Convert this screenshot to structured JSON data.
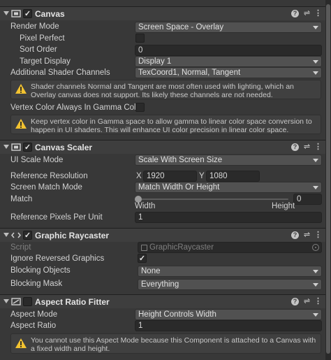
{
  "canvas": {
    "title": "Canvas",
    "render_mode_label": "Render Mode",
    "render_mode_value": "Screen Space - Overlay",
    "pixel_perfect_label": "Pixel Perfect",
    "sort_order_label": "Sort Order",
    "sort_order_value": "0",
    "target_display_label": "Target Display",
    "target_display_value": "Display 1",
    "shader_channels_label": "Additional Shader Channels",
    "shader_channels_value": "TexCoord1, Normal, Tangent",
    "warning1": "Shader channels Normal and Tangent are most often used with lighting, which an Overlay canvas does not support. Its likely these channels are not needed.",
    "vertex_color_label": "Vertex Color Always In Gamma Color",
    "warning2": "Keep vertex color in Gamma space to allow gamma to linear color space conversion to happen in UI shaders. This will enhance UI color precision in linear color space."
  },
  "canvas_scaler": {
    "title": "Canvas Scaler",
    "ui_scale_mode_label": "UI Scale Mode",
    "ui_scale_mode_value": "Scale With Screen Size",
    "ref_resolution_label": "Reference Resolution",
    "x_label": "X",
    "x_value": "1920",
    "y_label": "Y",
    "y_value": "1080",
    "screen_match_mode_label": "Screen Match Mode",
    "screen_match_mode_value": "Match Width Or Height",
    "match_label": "Match",
    "match_value": "0",
    "match_min_label": "Width",
    "match_max_label": "Height",
    "ref_ppu_label": "Reference Pixels Per Unit",
    "ref_ppu_value": "1"
  },
  "graphic_raycaster": {
    "title": "Graphic Raycaster",
    "script_label": "Script",
    "script_value": "GraphicRaycaster",
    "ignore_reversed_label": "Ignore Reversed Graphics",
    "blocking_objects_label": "Blocking Objects",
    "blocking_objects_value": "None",
    "blocking_mask_label": "Blocking Mask",
    "blocking_mask_value": "Everything"
  },
  "aspect_ratio_fitter": {
    "title": "Aspect Ratio Fitter",
    "aspect_mode_label": "Aspect Mode",
    "aspect_mode_value": "Height Controls Width",
    "aspect_ratio_label": "Aspect Ratio",
    "aspect_ratio_value": "1",
    "warning": "You cannot use this Aspect Mode because this Component is attached to a Canvas with a fixed width and height."
  },
  "header_buttons": {
    "help": "?",
    "preset": "⇌",
    "menu": "⋮"
  },
  "check_mark": "✓",
  "colors": {
    "background": "#383838",
    "header": "#3e3e3e",
    "field": "#2a2a2a",
    "warning_icon": "#f2c230"
  }
}
